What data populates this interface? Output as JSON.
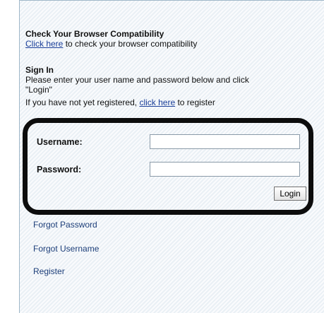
{
  "compatibility": {
    "heading": "Check Your Browser Compatibility",
    "link_text": "Click here",
    "suffix": " to check your browser compatibility"
  },
  "signin": {
    "heading": "Sign In",
    "instructions_line1": "Please enter your user name and password below and click",
    "instructions_line2": "\"Login\"",
    "register_prefix": "If you have not yet registered, ",
    "register_link": "click here",
    "register_suffix": " to register"
  },
  "form": {
    "username_label": "Username:",
    "password_label": "Password:",
    "username_value": "",
    "password_value": "",
    "login_button": "Login"
  },
  "links": {
    "forgot_password": "Forgot Password",
    "forgot_username": "Forgot Username",
    "register": "Register"
  },
  "colors": {
    "link": "#1a3e99",
    "annotation_outline": "#0d0d0d",
    "panel_bg": "#f3f7fa"
  }
}
